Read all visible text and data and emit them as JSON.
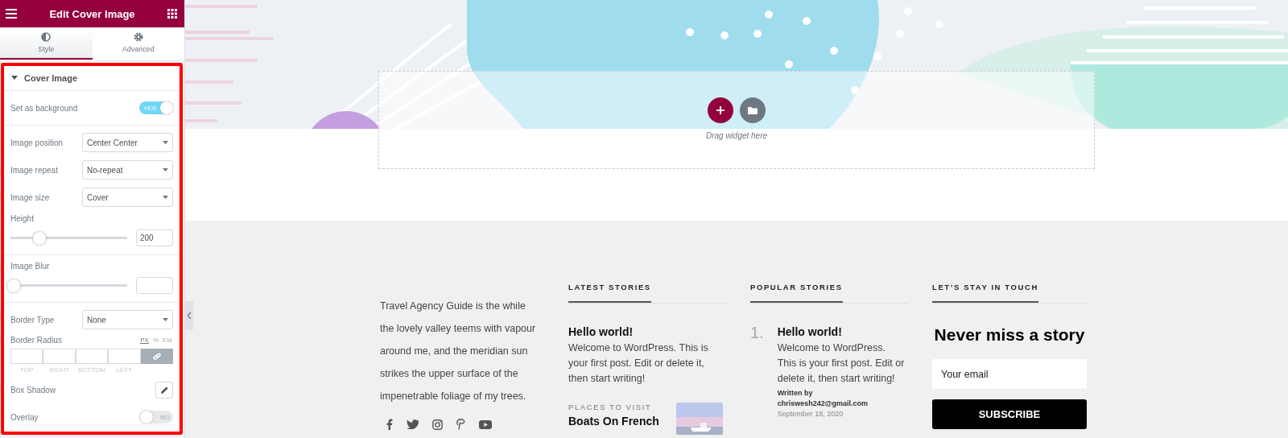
{
  "panel": {
    "title": "Edit Cover Image",
    "tabs": [
      {
        "label": "Style",
        "selected": true
      },
      {
        "label": "Advanced",
        "selected": false
      }
    ],
    "section": {
      "title": "Cover Image",
      "expanded": true
    },
    "groups": [
      {
        "controls": [
          {
            "kind": "switch",
            "label": "Set as background",
            "on": true,
            "text": "YES"
          }
        ]
      },
      {
        "controls": [
          {
            "kind": "select",
            "label": "Image position",
            "value": "Center Center"
          },
          {
            "kind": "select",
            "label": "Image repeat",
            "value": "No-repeat"
          },
          {
            "kind": "select",
            "label": "Image size",
            "value": "Cover"
          },
          {
            "kind": "slider",
            "label": "Height",
            "level": 0.22,
            "value": "200"
          }
        ]
      },
      {
        "controls": [
          {
            "kind": "slider",
            "label": "Image Blur",
            "level": 0
          }
        ]
      },
      {
        "controls": [
          {
            "kind": "select",
            "label": "Border Type",
            "value": "None"
          },
          {
            "kind": "dimensions",
            "label": "Border Radius",
            "units": [
              {
                "label": "PX",
                "selected": true
              },
              {
                "label": "%",
                "selected": false
              },
              {
                "label": "EM",
                "selected": false
              }
            ],
            "sides": [
              "TOP",
              "RIGHT",
              "BOTTOM",
              "LEFT"
            ]
          },
          {
            "kind": "popover",
            "label": "Box Shadow"
          },
          {
            "kind": "switch",
            "label": "Overlay",
            "on": false,
            "text": "NO"
          }
        ]
      }
    ]
  },
  "canvas": {
    "drop_hint": "Drag widget here"
  },
  "footer": {
    "about": "Travel Agency Guide is the while the lovely valley teems with vapour around me, and the meridian sun strikes the upper surface of the impenetrable foliage of my trees.",
    "latest": {
      "heading": "LATEST STORIES",
      "title": "Hello world!",
      "excerpt": "Welcome to WordPress. This is your first post. Edit or delete it, then start writing!",
      "category": "PLACES TO VISIT",
      "feature_title": "Boats On French"
    },
    "popular": {
      "heading": "POPULAR STORIES",
      "number": "1.",
      "title": "Hello world!",
      "excerpt": "Welcome to WordPress. This is your first post. Edit or delete it, then start writing!",
      "byline": "Written by",
      "author": "chriswesh242@gmail.com",
      "date": "September 18, 2020"
    },
    "touch": {
      "heading": "LET’S STAY IN TOUCH",
      "title": "Never miss a story",
      "placeholder": "Your email",
      "button": "SUBSCRIBE"
    }
  }
}
